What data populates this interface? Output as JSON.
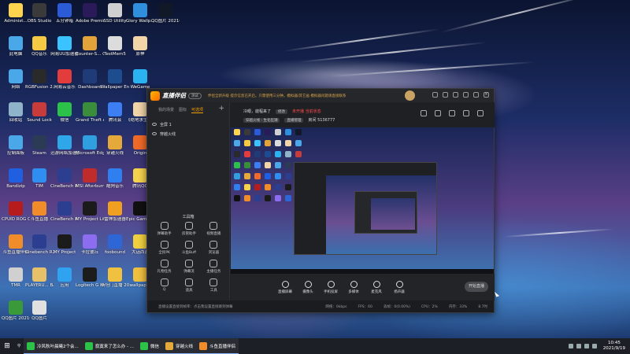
{
  "desktop_icons": [
    {
      "label": "Administ...",
      "color": "#ffd34d"
    },
    {
      "label": "OBS Studio",
      "color": "#3a3a3a"
    },
    {
      "label": "五分钟暗",
      "color": "#2b5bd7"
    },
    {
      "label": "Adobe Premie...",
      "color": "#2a1a5a"
    },
    {
      "label": "SSD Utility",
      "color": "#d0d0d0"
    },
    {
      "label": "Glory Wallp...",
      "color": "#2f8fdc"
    },
    {
      "label": "QQ图片 20210919...",
      "color": "#111827"
    },
    {
      "label": "此电脑",
      "color": "#4aa7e8"
    },
    {
      "label": "QQ音乐",
      "color": "#f6c945"
    },
    {
      "label": "网易UU加速器",
      "color": "#3ac3ff"
    },
    {
      "label": "Counter-S... Global Off...",
      "color": "#e2a33b"
    },
    {
      "label": "TestMem5",
      "color": "#dcdcdc"
    },
    {
      "label": "原神",
      "color": "#f1d5a8"
    },
    {
      "label": "网络",
      "color": "#4aa7e8"
    },
    {
      "label": "RGBFusion 2.0",
      "color": "#2a2a2a"
    },
    {
      "label": "网易云音乐",
      "color": "#e23c3c"
    },
    {
      "label": "Dashboard",
      "color": "#1f3b78"
    },
    {
      "label": "Wallpaper Engine...",
      "color": "#1d4d8f"
    },
    {
      "label": "WeGame",
      "color": "#2ab3f0"
    },
    {
      "label": "回收站",
      "color": "#8fb3c9"
    },
    {
      "label": "Sound Lock",
      "color": "#c73b3b"
    },
    {
      "label": "微信",
      "color": "#2cc24a"
    },
    {
      "label": "Grand Theft Auto V",
      "color": "#3a8d3a"
    },
    {
      "label": "腾讯会",
      "color": "#3b7ff3"
    },
    {
      "label": "《绝地求生》...",
      "color": "#f1d5a8"
    },
    {
      "label": "控制面板",
      "color": "#4aa7e8"
    },
    {
      "label": "Steam",
      "color": "#2b3a55"
    },
    {
      "label": "迅游网络加速器",
      "color": "#2fa6e8"
    },
    {
      "label": "Microsoft Edge",
      "color": "#2f9fe0"
    },
    {
      "label": "穿越火线",
      "color": "#e5a83a"
    },
    {
      "label": "Origin",
      "color": "#f06a28"
    },
    {
      "label": "Bandizip",
      "color": "#1f5fe0"
    },
    {
      "label": "TIM",
      "color": "#2f8ff0"
    },
    {
      "label": "CineBench R15",
      "color": "#2c3e8f"
    },
    {
      "label": "MSI Afterburner",
      "color": "#c02c2c"
    },
    {
      "label": "酷狗音乐",
      "color": "#2f7ff0"
    },
    {
      "label": "腾讯QQ",
      "color": "#f6d34d"
    },
    {
      "label": "CPUID ROG CPU-Z",
      "color": "#b71c1c"
    },
    {
      "label": "斗鱼直播",
      "color": "#f08c2a"
    },
    {
      "label": "CineBench R20",
      "color": "#2c3e8f"
    },
    {
      "label": "MY Project Lifehunk",
      "color": "#1b1b1b"
    },
    {
      "label": "雷神加速器",
      "color": "#f0a020"
    },
    {
      "label": "Epic Games Launcher",
      "color": "#111111"
    },
    {
      "label": "斗鱼直播伴侣",
      "color": "#f08c2a"
    },
    {
      "label": "Cinebench R23",
      "color": "#2c3e8f"
    },
    {
      "label": "MY Project",
      "color": "#1b1b1b"
    },
    {
      "label": "卡拉彼丘",
      "color": "#8c6df0"
    },
    {
      "label": "foobound",
      "color": "#2f66d6"
    },
    {
      "label": "大话西游",
      "color": "#f0d040"
    },
    {
      "label": "TMR",
      "color": "#d0d0d0"
    },
    {
      "label": "PLAYERU... BATTLEGR...",
      "color": "#e7c16a"
    },
    {
      "label": "应用",
      "color": "#2fa2f0"
    },
    {
      "label": "Logitech G HUB",
      "color": "#1c1c1c"
    },
    {
      "label": "斯坦门直播 2021",
      "color": "#f0c040"
    },
    {
      "label": "wallpaper",
      "color": "#f0c040"
    },
    {
      "label": "QQ图片 20210919...",
      "color": "#3a9a3a"
    },
    {
      "label": "QQ图片",
      "color": "#e0e0e0"
    }
  ],
  "app": {
    "title": "直播伴侣",
    "version": "测试",
    "notice": "伴侣全新升级 提示信息已开启，只需使用三分钟。模拟器/其它画 模拟器问题请直接联系",
    "scene_tabs": [
      "我的场景",
      "图标",
      "可选项"
    ],
    "sources": [
      "全屏 1",
      "穿越火线"
    ],
    "tools_title": "工具箱",
    "tools": [
      "弹幕助手",
      "房管助手",
      "视频直播",
      "全民PK",
      "斗鱼Buff",
      "浏览器",
      "礼物任务",
      "弹幕流",
      "主播任务",
      "Q",
      "道具",
      "工具"
    ],
    "stream": {
      "title_label": "冷眼，啟程来了",
      "edit": "修改",
      "status": "未开播 当前状态",
      "category": "穿越火线 - 生化狂潮",
      "room_label": "直播管理",
      "room_id": "房间 5136777"
    },
    "bottom_tools": [
      "直播屏幕",
      "摄像头",
      "手机投屏",
      "多媒体",
      "麦克风",
      "扬声器"
    ],
    "go_live": "开始直播",
    "status_left": "直播设置直接到帧率：点击我设置直接跳到弹幕",
    "status_right": [
      "网络：0kbps",
      "FPS：60",
      "丢帧：0(0.00%)",
      "CPU：2%",
      "内存：33%",
      "8.7时"
    ]
  },
  "taskbar": {
    "items": [
      {
        "label": "冷风秋叶晨曦2个会...",
        "color": "#2cc24a"
      },
      {
        "label": "寂寞来了怎么办 - ...",
        "color": "#2cc24a"
      },
      {
        "label": "微信",
        "color": "#2cc24a"
      },
      {
        "label": "穿越火线",
        "color": "#e5a83a"
      },
      {
        "label": "斗鱼直播伴侣",
        "color": "#f08c2a"
      }
    ],
    "time": "10:45",
    "date": "2021/9/19"
  },
  "colors": {
    "accent": "#f2a100",
    "window_bg": "#1f2024",
    "taskbar_bg": "#1c1f26"
  }
}
